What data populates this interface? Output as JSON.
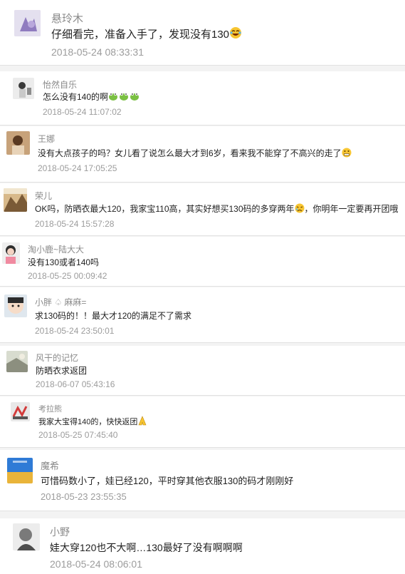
{
  "comments": [
    {
      "name": "悬玲木",
      "text": "仔细看完，准备入手了，发现没有130",
      "time": "2018-05-24 08:33:31",
      "emoji": "laughing-crying-emoji"
    },
    {
      "name": "怡然自乐",
      "text": "怎么没有140的啊",
      "time": "2018-05-24 11:07:02",
      "emoji": "frog-emoji"
    },
    {
      "name": "王娜",
      "text": "没有大点孩子的吗？女儿看了说怎么最大才到6岁，看来我不能穿了不高兴的走了",
      "time": "2018-05-24 17:05:25",
      "emoji": "grimace-emoji"
    },
    {
      "name": "荣儿",
      "text": "OK吗，防晒衣最大120，我家宝110高，其实好想买130码的多穿两年",
      "text_after": "，你明年一定要再开团哦",
      "time": "2018-05-24 15:57:28",
      "emoji": "sad-emoji"
    },
    {
      "name": "淘小鹿~陆大大",
      "text": "没有130或者140吗",
      "time": "2018-05-25 00:09:42"
    },
    {
      "name": "小胖 ♤ 麻麻=",
      "text": "求130码的！！最大才120的满足不了需求",
      "time": "2018-05-24 23:50:01"
    },
    {
      "name": "风干的记忆",
      "text": "防晒衣求返团",
      "time": "2018-06-07 05:43:16"
    },
    {
      "name": "考拉熊",
      "text": "我家大宝得140的，快快返团",
      "time": "2018-05-25 07:45:40",
      "emoji": "pray-emoji"
    },
    {
      "name": "魔希",
      "text": "可惜码数小了，娃已经120，平时穿其他衣服130的码才刚刚好",
      "time": "2018-05-23 23:55:35"
    },
    {
      "name": "小野",
      "text": "娃大穿120也不大啊…130最好了没有啊啊啊",
      "time": "2018-05-24 08:06:01"
    }
  ]
}
